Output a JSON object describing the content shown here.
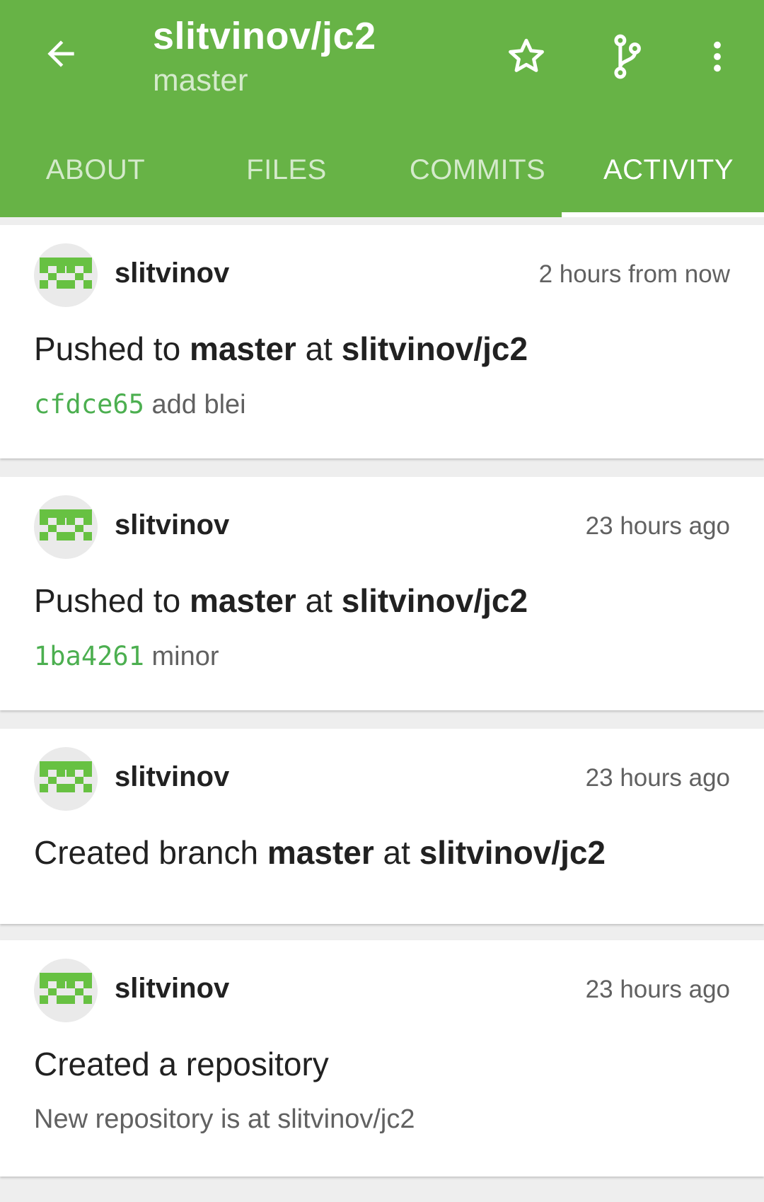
{
  "header": {
    "title": "slitvinov/jc2",
    "subtitle": "master",
    "back_icon": "arrow-back-icon",
    "actions": [
      "star-icon",
      "branch-icon",
      "more-vert-icon"
    ],
    "color": "#67b346"
  },
  "tabs": [
    {
      "label": "ABOUT",
      "active": false
    },
    {
      "label": "FILES",
      "active": false
    },
    {
      "label": "COMMITS",
      "active": false
    },
    {
      "label": "ACTIVITY",
      "active": true
    }
  ],
  "events": [
    {
      "user": "slitvinov",
      "time": "2 hours from now",
      "parts": [
        "Pushed to ",
        "master",
        " at ",
        "slitvinov/jc2"
      ],
      "sha": "cfdce65",
      "message": "add blei"
    },
    {
      "user": "slitvinov",
      "time": "23 hours ago",
      "parts": [
        "Pushed to ",
        "master",
        " at ",
        "slitvinov/jc2"
      ],
      "sha": "1ba4261",
      "message": "minor"
    },
    {
      "user": "slitvinov",
      "time": "23 hours ago",
      "parts": [
        "Created branch ",
        "master",
        " at ",
        "slitvinov/jc2"
      ]
    },
    {
      "user": "slitvinov",
      "time": "23 hours ago",
      "parts": [
        "Created a repository"
      ],
      "description": "New repository is at slitvinov/jc2"
    }
  ]
}
